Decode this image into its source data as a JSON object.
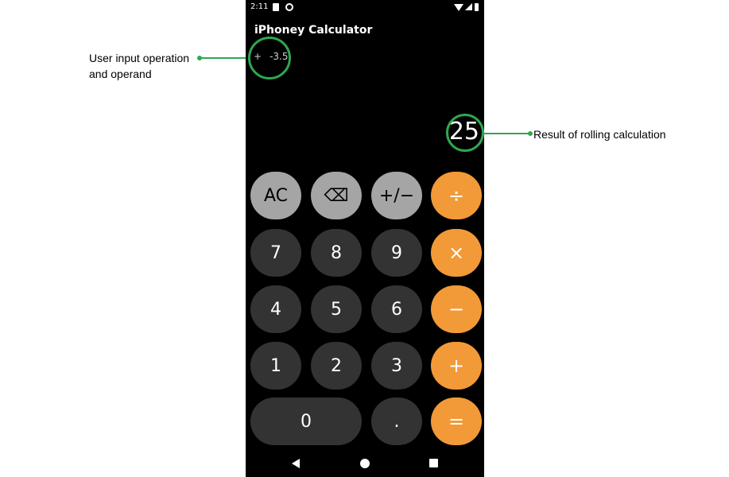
{
  "annotations": {
    "input_label_line1": "User input operation",
    "input_label_line2": "and operand",
    "result_label": "Result of rolling calculation"
  },
  "status_bar": {
    "time": "2:11",
    "icons": [
      "sd-card-icon",
      "rotation-icon",
      "wifi-icon",
      "signal-icon",
      "battery-icon"
    ]
  },
  "app": {
    "title": "iPhoney Calculator",
    "input_operation": "+",
    "input_operand": "-3.5",
    "result": "25"
  },
  "keys": {
    "ac": "AC",
    "backspace": "⌫",
    "sign": "+/−",
    "divide": "÷",
    "seven": "7",
    "eight": "8",
    "nine": "9",
    "multiply": "×",
    "four": "4",
    "five": "5",
    "six": "6",
    "minus": "−",
    "one": "1",
    "two": "2",
    "three": "3",
    "plus": "+",
    "zero": "0",
    "decimal": ".",
    "equals": "="
  },
  "colors": {
    "accent_green": "#2ea84f",
    "operator_orange": "#f29a38",
    "function_gray": "#a5a5a5",
    "digit_dark": "#333333"
  },
  "nav_bar": {
    "icons": [
      "back-icon",
      "home-icon",
      "recents-icon"
    ]
  }
}
